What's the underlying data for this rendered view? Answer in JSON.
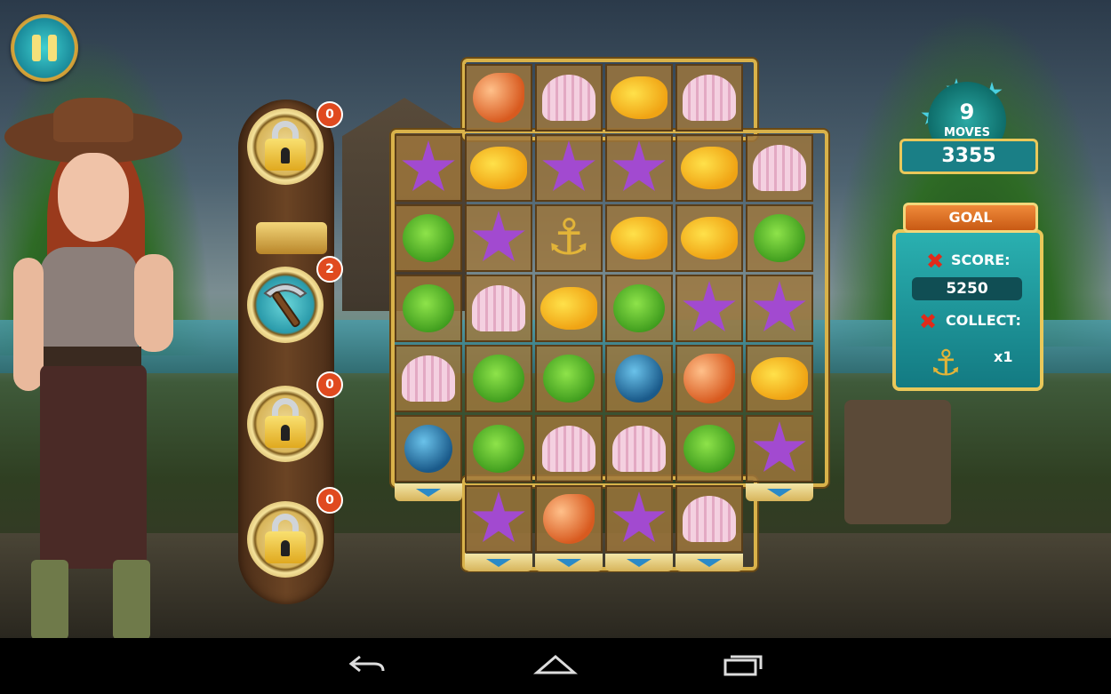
{
  "hud": {
    "pause_icon": "pause-icon",
    "moves": "9",
    "moves_label": "MOVES",
    "score": "3355",
    "stars_icon": "star-icon"
  },
  "boosters": [
    {
      "name": "locked",
      "icon": "lock-icon",
      "count": "0"
    },
    {
      "name": "pickaxe",
      "icon": "pickaxe-icon",
      "count": "2"
    },
    {
      "name": "locked",
      "icon": "lock-icon",
      "count": "0"
    },
    {
      "name": "locked",
      "icon": "lock-icon",
      "count": "0"
    }
  ],
  "goal": {
    "title": "GOAL",
    "score_label": "SCORE:",
    "score_target": "5250",
    "collect_label": "COLLECT:",
    "collect_icon": "anchor-icon",
    "collect_count": "x1"
  },
  "board": {
    "rows": [
      [
        null,
        "conch",
        "shell",
        "fish",
        "shell",
        null
      ],
      [
        "star",
        "fish",
        "star",
        "star",
        "fish",
        "shell"
      ],
      [
        "puffer",
        "star",
        "anchor",
        "fish",
        "fish",
        "puffer"
      ],
      [
        "puffer",
        "shell",
        "fish",
        "puffer",
        "star",
        "star"
      ],
      [
        "shell",
        "puffer",
        "puffer",
        "bomb",
        "conch",
        "fish"
      ],
      [
        "bomb",
        "puffer",
        "shell",
        "shell",
        "puffer",
        "star"
      ],
      [
        null,
        "star",
        "conch",
        "star",
        "shell",
        null
      ]
    ]
  },
  "navbar": {
    "back_icon": "back-icon",
    "home_icon": "home-icon",
    "recents_icon": "recents-icon"
  }
}
